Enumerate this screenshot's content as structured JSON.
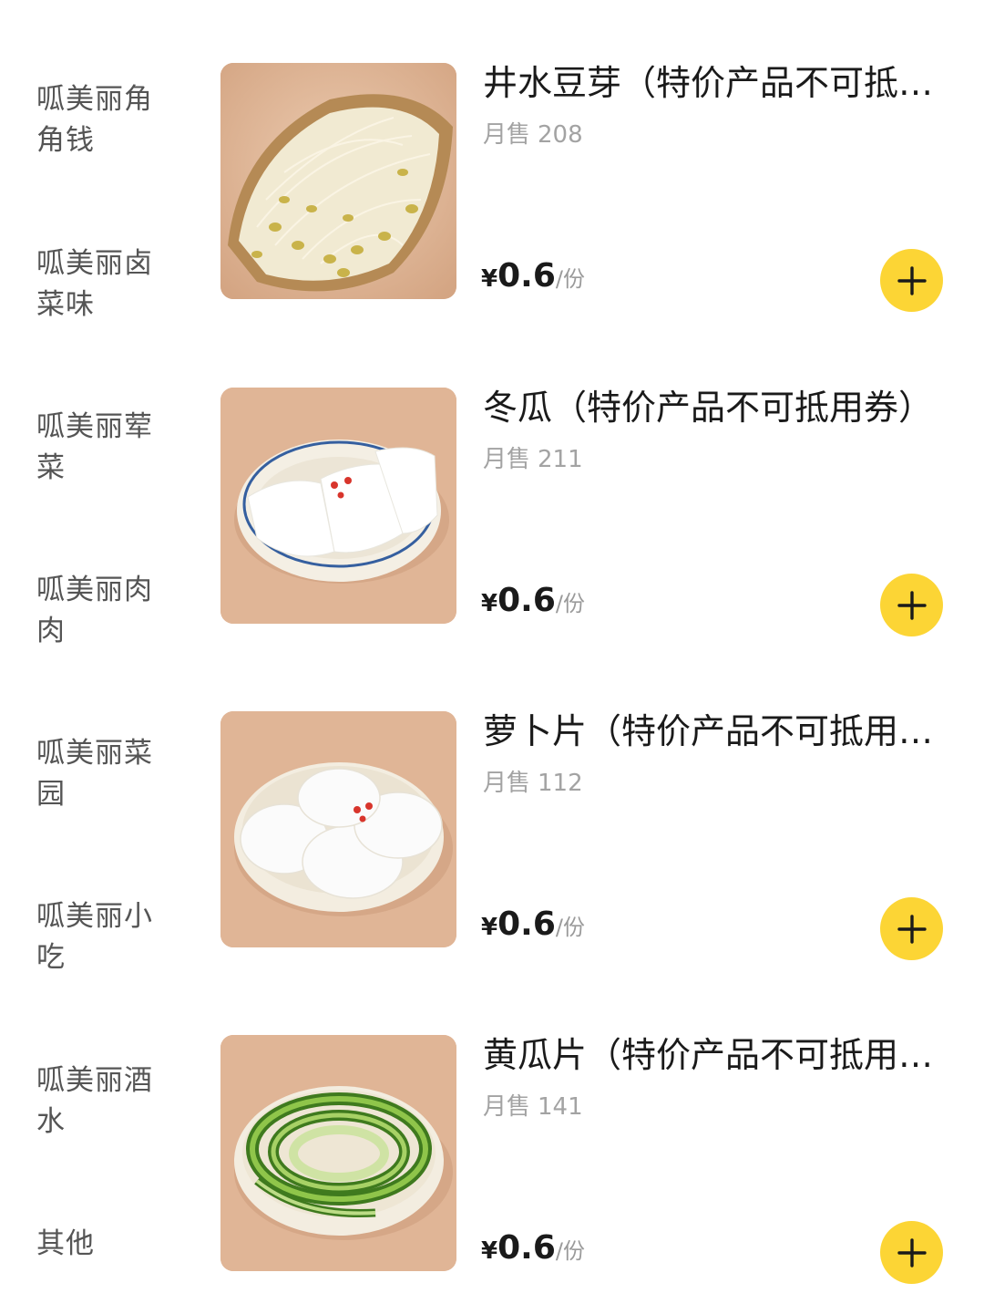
{
  "sidebar": {
    "categories": [
      {
        "label": "呱美丽角角钱"
      },
      {
        "label": "呱美丽卤菜味"
      },
      {
        "label": "呱美丽荤菜"
      },
      {
        "label": "呱美丽肉肉"
      },
      {
        "label": "呱美丽菜园"
      },
      {
        "label": "呱美丽小吃"
      },
      {
        "label": "呱美丽酒水"
      },
      {
        "label": "其他"
      }
    ]
  },
  "products": [
    {
      "name": "井水豆芽（特价产品不可抵用券）",
      "sales_label": "月售",
      "sales_count": "208",
      "currency": "¥",
      "price": "0.6",
      "unit": "/份",
      "image_icon": "bean-sprouts-image"
    },
    {
      "name": "冬瓜（特价产品不可抵用券）",
      "sales_label": "月售",
      "sales_count": "211",
      "currency": "¥",
      "price": "0.6",
      "unit": "/份",
      "image_icon": "winter-melon-image"
    },
    {
      "name": "萝卜片（特价产品不可抵用券）",
      "sales_label": "月售",
      "sales_count": "112",
      "currency": "¥",
      "price": "0.6",
      "unit": "/份",
      "image_icon": "radish-slices-image"
    },
    {
      "name": "黄瓜片（特价产品不可抵用券）",
      "sales_label": "月售",
      "sales_count": "141",
      "currency": "¥",
      "price": "0.6",
      "unit": "/份",
      "image_icon": "cucumber-slices-image"
    }
  ],
  "colors": {
    "accent": "#fcd535",
    "text_primary": "#1a1a1a",
    "text_secondary": "#a3a3a3",
    "image_bg": "#e2b99c"
  },
  "icons": {
    "add": "plus-icon"
  }
}
